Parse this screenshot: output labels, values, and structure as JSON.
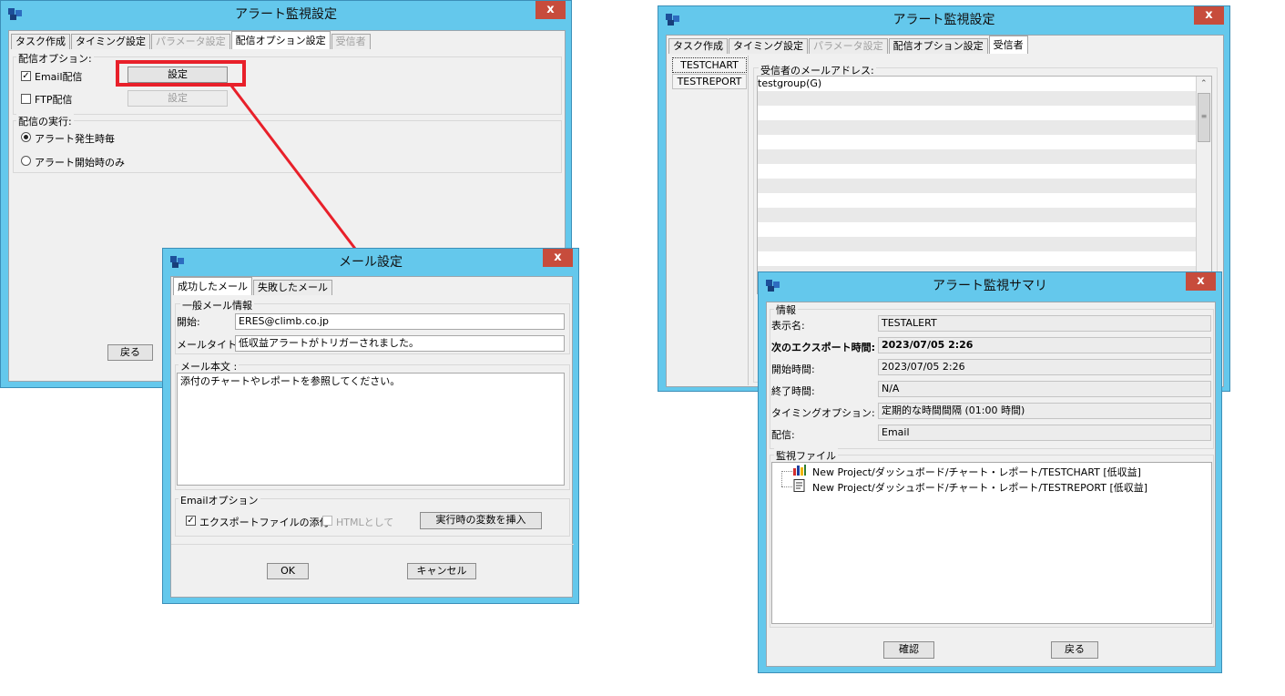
{
  "win1": {
    "title": "アラート監視設定",
    "close": "x",
    "tabs": [
      {
        "label": "タスク作成"
      },
      {
        "label": "タイミング設定"
      },
      {
        "label": "パラメータ設定"
      },
      {
        "label": "配信オプション設定"
      },
      {
        "label": "受信者"
      }
    ],
    "delivery_group": "配信オプション:",
    "email_label": "Email配信",
    "email_setting": "設定",
    "ftp_label": "FTP配信",
    "ftp_setting": "設定",
    "exec_group": "配信の実行:",
    "radio_each": "アラート発生時毎",
    "radio_start": "アラート開始時のみ",
    "back": "戻る"
  },
  "mail": {
    "title": "メール設定",
    "close": "x",
    "tabs": [
      {
        "label": "成功したメール"
      },
      {
        "label": "失敗したメール"
      }
    ],
    "general_group": "一般メール情報",
    "from_label": "開始:",
    "from_value": "ERES@climb.co.jp",
    "subject_label": "メールタイトル:",
    "subject_value": "低収益アラートがトリガーされました。",
    "body_group": "メール本文 :",
    "body_value": "添付のチャートやレポートを参照してください。",
    "options_group": "Emailオプション",
    "attach_label": "エクスポートファイルの添付",
    "html_label": "HTMLとして",
    "insert_vars": "実行時の変数を挿入",
    "ok": "OK",
    "cancel": "キャンセル"
  },
  "win2": {
    "title": "アラート監視設定",
    "close": "x",
    "tabs": [
      {
        "label": "タスク作成"
      },
      {
        "label": "タイミング設定"
      },
      {
        "label": "パラメータ設定"
      },
      {
        "label": "配信オプション設定"
      },
      {
        "label": "受信者"
      }
    ],
    "recipients": [
      {
        "label": "TESTCHART"
      },
      {
        "label": "TESTREPORT"
      }
    ],
    "address_label": "受信者のメールアドレス:",
    "addresses": [
      "testgroup(G)"
    ]
  },
  "summary": {
    "title": "アラート監視サマリ",
    "close": "x",
    "info_group": "情報",
    "rows": [
      {
        "label": "表示名:",
        "value": "TESTALERT"
      },
      {
        "label": "次のエクスポート時間:",
        "value": "2023/07/05 2:26"
      },
      {
        "label": "開始時間:",
        "value": "2023/07/05 2:26"
      },
      {
        "label": "終了時間:",
        "value": "N/A"
      },
      {
        "label": "タイミングオプション:",
        "value": "定期的な時間間隔 (01:00 時間)"
      },
      {
        "label": "配信:",
        "value": "Email"
      }
    ],
    "files_group": "監視ファイル",
    "files": [
      {
        "label": "New Project/ダッシュボード/チャート・レポート/TESTCHART [低収益]",
        "icon": "chart-icon"
      },
      {
        "label": "New Project/ダッシュボード/チャート・レポート/TESTREPORT [低収益]",
        "icon": "report-icon"
      }
    ],
    "confirm": "確認",
    "back": "戻る"
  }
}
